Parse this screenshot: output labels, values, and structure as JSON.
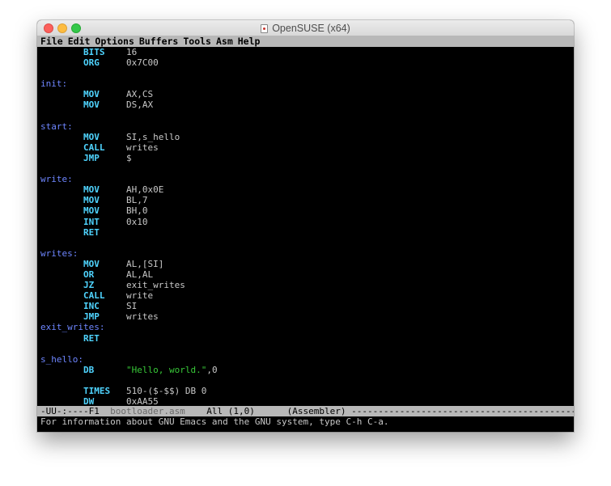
{
  "window": {
    "title": "OpenSUSE (x64)"
  },
  "menu": [
    "File",
    "Edit",
    "Options",
    "Buffers",
    "Tools",
    "Asm",
    "Help"
  ],
  "code": [
    {
      "label": "",
      "op": "BITS",
      "args": "16"
    },
    {
      "label": "",
      "op": "ORG",
      "args": "0x7C00"
    },
    {
      "label": "",
      "op": "",
      "args": ""
    },
    {
      "label": "init:",
      "op": "",
      "args": ""
    },
    {
      "label": "",
      "op": "MOV",
      "args": "AX,CS"
    },
    {
      "label": "",
      "op": "MOV",
      "args": "DS,AX"
    },
    {
      "label": "",
      "op": "",
      "args": ""
    },
    {
      "label": "start:",
      "op": "",
      "args": ""
    },
    {
      "label": "",
      "op": "MOV",
      "args": "SI,s_hello"
    },
    {
      "label": "",
      "op": "CALL",
      "args": "writes"
    },
    {
      "label": "",
      "op": "JMP",
      "args": "$"
    },
    {
      "label": "",
      "op": "",
      "args": ""
    },
    {
      "label": "write:",
      "op": "",
      "args": ""
    },
    {
      "label": "",
      "op": "MOV",
      "args": "AH,0x0E"
    },
    {
      "label": "",
      "op": "MOV",
      "args": "BL,7"
    },
    {
      "label": "",
      "op": "MOV",
      "args": "BH,0"
    },
    {
      "label": "",
      "op": "INT",
      "args": "0x10"
    },
    {
      "label": "",
      "op": "RET",
      "args": ""
    },
    {
      "label": "",
      "op": "",
      "args": ""
    },
    {
      "label": "writes:",
      "op": "",
      "args": ""
    },
    {
      "label": "",
      "op": "MOV",
      "args": "AL,[SI]"
    },
    {
      "label": "",
      "op": "OR",
      "args": "AL,AL"
    },
    {
      "label": "",
      "op": "JZ",
      "args": "exit_writes"
    },
    {
      "label": "",
      "op": "CALL",
      "args": "write"
    },
    {
      "label": "",
      "op": "INC",
      "args": "SI"
    },
    {
      "label": "",
      "op": "JMP",
      "args": "writes"
    },
    {
      "label": "exit_writes:",
      "op": "",
      "args": ""
    },
    {
      "label": "",
      "op": "RET",
      "args": ""
    },
    {
      "label": "",
      "op": "",
      "args": ""
    },
    {
      "label": "s_hello:",
      "op": "",
      "args": ""
    },
    {
      "label": "",
      "op": "DB",
      "args": "",
      "str": "\"Hello, world.\"",
      "tail": ",0"
    },
    {
      "label": "",
      "op": "",
      "args": ""
    },
    {
      "label": "",
      "op": "TIMES",
      "args": "510-($-$$) DB 0"
    },
    {
      "label": "",
      "op": "DW",
      "args": "0xAA55"
    }
  ],
  "modeline": {
    "status": "-UU-:----F1  ",
    "filename": "bootloader.asm",
    "position": "    All (1,0)      ",
    "mode": "(Assembler)",
    "fill": " ----------------------------------------------------------------"
  },
  "minibuffer": "For information about GNU Emacs and the GNU system, type C-h C-a.",
  "colors": {
    "label": "#6e86ff",
    "keyword": "#4fd4ff",
    "string": "#38c838",
    "text": "#c8c8c8",
    "modeline_bg": "#b8b8b8"
  }
}
